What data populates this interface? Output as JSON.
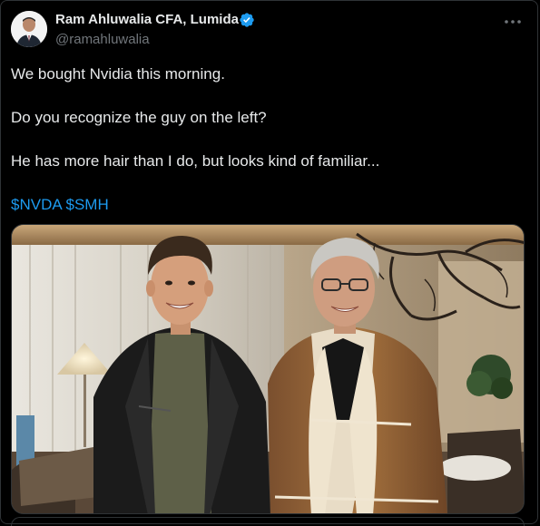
{
  "author": {
    "display_name": "Ram Ahluwalia CFA, Lumida",
    "handle": "@ramahluwalia",
    "verified": true,
    "avatar_icon": "profile-photo"
  },
  "menu_icon": "more-horizontal-icon",
  "tweet": {
    "line1": "We bought Nvidia this morning.",
    "line2": "Do you recognize the guy on the left?",
    "line3": "He has more hair than I do, but looks kind of familiar...",
    "cashtag1": "$NVDA",
    "cashtag2": "$SMH"
  },
  "colors": {
    "background": "#000000",
    "text": "#e7e9ea",
    "secondary": "#71767b",
    "link": "#1d9bf0",
    "verified": "#1d9bf0",
    "border": "#2f3336"
  }
}
